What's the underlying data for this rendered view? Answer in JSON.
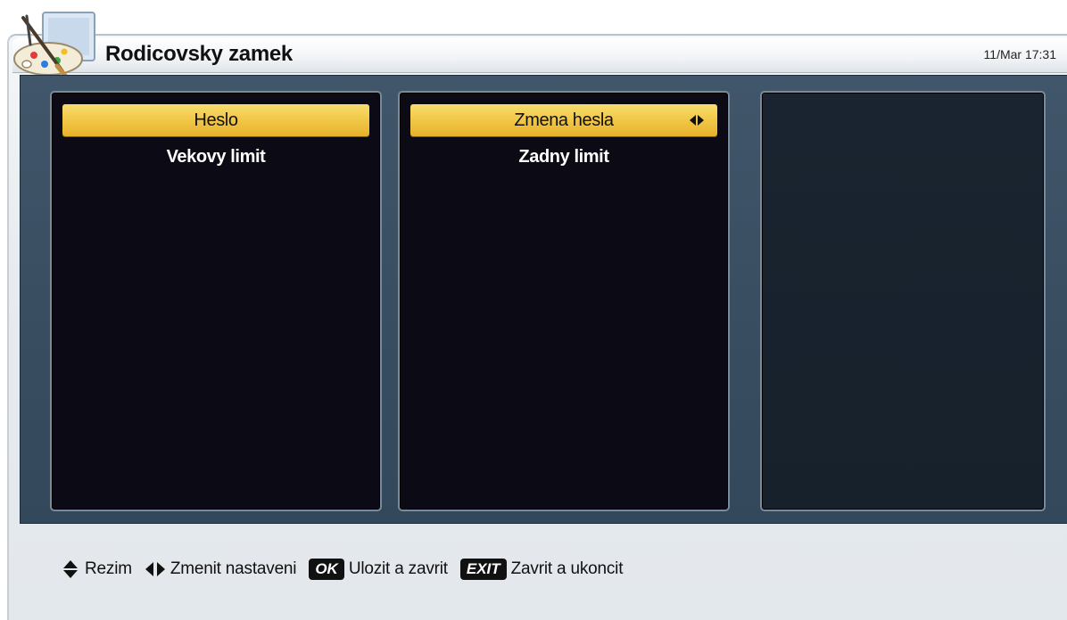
{
  "header": {
    "title": "Rodicovsky zamek",
    "clock": "11/Mar 17:31",
    "icon": "palette-icon"
  },
  "left_panel": {
    "items": [
      {
        "label": "Heslo",
        "selected": true
      },
      {
        "label": "Vekovy limit",
        "selected": false
      }
    ]
  },
  "middle_panel": {
    "items": [
      {
        "label": "Zmena hesla",
        "selected": true,
        "icon": "left-right-arrows-icon"
      },
      {
        "label": "Zadny limit",
        "selected": false
      }
    ]
  },
  "right_panel": {
    "items": []
  },
  "footer": {
    "legend": [
      {
        "icon": "up-down-arrows-icon",
        "label": "Rezim"
      },
      {
        "icon": "left-right-arrows-icon",
        "label": "Zmenit nastaveni"
      },
      {
        "key": "OK",
        "label": "Ulozit a zavrit"
      },
      {
        "key": "EXIT",
        "label": "Zavrit a ukoncit"
      }
    ]
  },
  "colors": {
    "highlight": "#f2c94a",
    "panel_bg": "#0c0a14",
    "well_bg": "#3a4e62",
    "frame_bg": "#e7ebef"
  }
}
